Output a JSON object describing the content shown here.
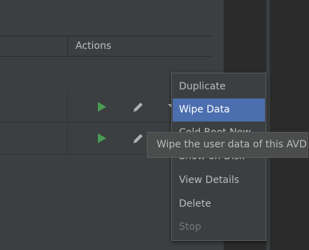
{
  "table": {
    "header": {
      "actions_label": "Actions"
    },
    "rows": [
      {
        "actions": [
          "play",
          "edit",
          "more"
        ]
      },
      {
        "actions": [
          "play",
          "edit",
          "more"
        ]
      }
    ]
  },
  "colors": {
    "play_green": "#499c54",
    "selection_blue": "#4b6eaf",
    "panel_bg": "#3c3f41",
    "dark_bg": "#2b2b2b"
  },
  "context_menu": {
    "items": [
      {
        "label": "Duplicate",
        "state": "normal"
      },
      {
        "label": "Wipe Data",
        "state": "selected"
      },
      {
        "label": "Cold Boot Now",
        "state": "normal"
      },
      {
        "label": "Show on Disk",
        "state": "normal"
      },
      {
        "label": "View Details",
        "state": "normal"
      },
      {
        "label": "Delete",
        "state": "normal"
      },
      {
        "label": "Stop",
        "state": "disabled"
      }
    ]
  },
  "tooltip": {
    "text": "Wipe the user data of this AVD"
  },
  "icons": {
    "play": "play-icon",
    "edit": "pencil-icon",
    "more": "dropdown-arrow-icon"
  }
}
